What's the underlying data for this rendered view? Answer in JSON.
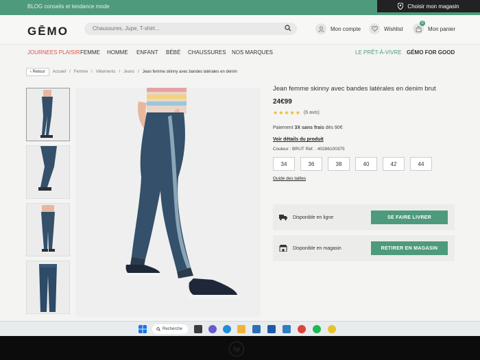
{
  "topbar": {
    "blog": "BLOG conseils et tendance mode",
    "store_label": "Choisir mon magasin"
  },
  "header": {
    "logo": "GĒMO",
    "search_placeholder": "Chaussures, Jupe, T-shirt...",
    "account": "Mon compte",
    "wishlist": "Wishlist",
    "cart": "Mon panier",
    "cart_count": "0"
  },
  "nav": {
    "items": [
      "JOURNEES PLAISIR",
      "FEMME",
      "HOMME",
      "ENFANT",
      "BÉBÉ",
      "CHAUSSURES",
      "NOS MARQUES"
    ],
    "right": [
      "LE PRÊT-À-VIVRE",
      "GÉMO FOR GOOD"
    ]
  },
  "breadcrumb": {
    "back": "Retour",
    "items": [
      "Accueil",
      "Femme",
      "Vêtements",
      "Jeans"
    ],
    "current": "Jean femme skinny avec bandes latérales en denim"
  },
  "product": {
    "title": "Jean femme skinny avec bandes latérales en denim brut",
    "price": "24€99",
    "rating": 5,
    "reviews": "(6 avis)",
    "pay_prefix": "Paiement",
    "pay_bold": "3X sans frais",
    "pay_suffix": "dès 90€",
    "details_link": "Voir détails du produit",
    "color_ref": "Couleur : BRUT   Réf. : 40286100375",
    "sizes": [
      "34",
      "36",
      "38",
      "40",
      "42",
      "44"
    ],
    "size_guide": "Guide des tailles"
  },
  "availability": {
    "online_label": "Disponible en ligne",
    "online_button": "SE FAIRE LIVRER",
    "store_label": "Disponible en magasin",
    "store_button": "RETIRER EN MAGASIN"
  },
  "taskbar": {
    "search": "Recherche"
  },
  "colors": {
    "accent_green": "#4e9a7c",
    "denim": "#34506a",
    "nav_red": "#d9534f"
  }
}
